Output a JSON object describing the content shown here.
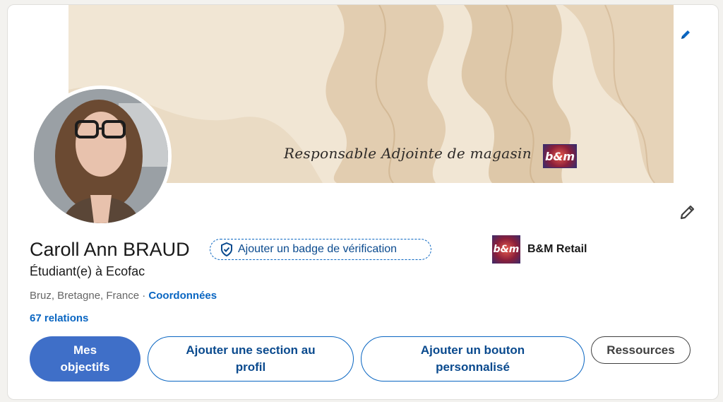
{
  "banner": {
    "text": "Responsable Adjointe de magasin",
    "logo_text": "b&m"
  },
  "profile": {
    "name": "Caroll Ann BRAUD",
    "verification_badge_label": "Ajouter un badge de vérification",
    "headline": "Étudiant(e) à Ecofac",
    "location": "Bruz, Bretagne, France",
    "separator": " · ",
    "contact_link": "Coordonnées",
    "relations": "67 relations"
  },
  "company": {
    "logo_text": "b&m",
    "name": "B&M Retail"
  },
  "actions": {
    "goals_line1": "Mes",
    "goals_line2": "objectifs",
    "add_section_line1": "Ajouter une section au",
    "add_section_line2": "profil",
    "custom_button_line1": "Ajouter un bouton",
    "custom_button_line2": "personnalisé",
    "resources": "Ressources"
  },
  "icons": {
    "edit_banner": "pencil-icon",
    "edit_profile": "pencil-icon",
    "verification": "shield-check-icon"
  },
  "colors": {
    "accent": "#0a66c2",
    "primary_button": "#3f6fc8",
    "banner_bg": "#efe3cf"
  }
}
